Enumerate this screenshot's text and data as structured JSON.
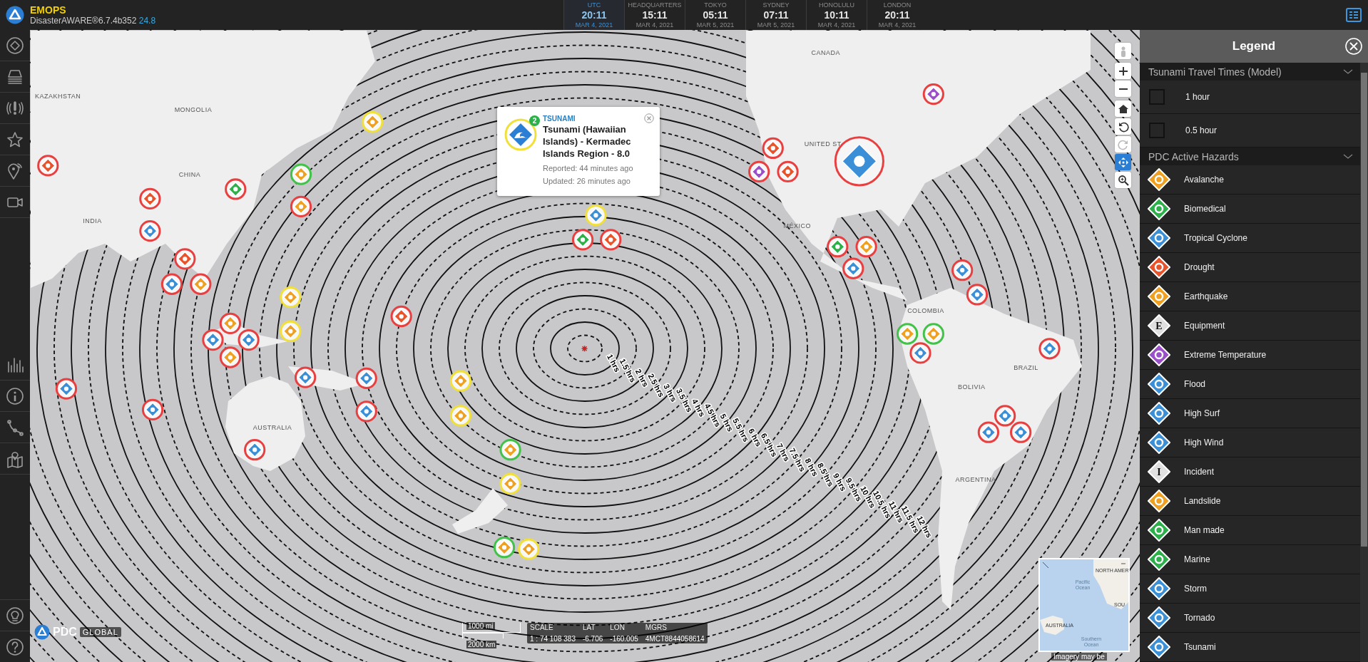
{
  "app": {
    "name": "EMOPS",
    "version": "DisasterAWARE®6.7.4b352",
    "build": "24.8"
  },
  "clocks": [
    {
      "label": "UTC",
      "time": "20:11",
      "date": "MAR 4, 2021",
      "selected": true
    },
    {
      "label": "HEADQUARTERS",
      "time": "15:11",
      "date": "MAR 4, 2021",
      "selected": false
    },
    {
      "label": "TOKYO",
      "time": "05:11",
      "date": "MAR 5, 2021",
      "selected": false
    },
    {
      "label": "SYDNEY",
      "time": "07:11",
      "date": "MAR 5, 2021",
      "selected": false
    },
    {
      "label": "HONOLULU",
      "time": "10:11",
      "date": "MAR 4, 2021",
      "selected": false
    },
    {
      "label": "LONDON",
      "time": "20:11",
      "date": "MAR 4, 2021",
      "selected": false
    }
  ],
  "map": {
    "places": [
      "KAZAKHSTAN",
      "MONGOLIA",
      "CHINA",
      "INDIA",
      "AUSTRALIA",
      "CANADA",
      "UNITED ST",
      "MÉXICO",
      "COLOMBIA",
      "BOLIVIA",
      "BRAZIL",
      "ARGENTINA"
    ],
    "contour_labels": [
      "1 hrs",
      "1.5 hrs",
      "2 hrs",
      "2.5 hrs",
      "3 hrs",
      "3.5 hrs",
      "4 hrs",
      "4.5 hrs",
      "5 hrs",
      "5.5 hrs",
      "6 hrs",
      "6.5 hrs",
      "7 hrs",
      "7.5 hrs",
      "8 hrs",
      "8.5 hrs",
      "9 hrs",
      "9.5 hrs",
      "10 hrs",
      "10.5 hrs",
      "11 hrs",
      "11.5 hrs",
      "12 hrs"
    ],
    "popup": {
      "category": "TSUNAMI",
      "count": "2",
      "title": "Tsunami (Hawaiian Islands) - Kermadec Islands Region - 8.0",
      "reported": "Reported: 44 minutes ago",
      "updated": "Updated: 26 minutes ago"
    },
    "logo": {
      "name": "PDC",
      "suffix": "GLOBAL"
    },
    "scale": {
      "miles": "1000 mi",
      "km": "2000 km"
    },
    "readouts": [
      {
        "label": "SCALE",
        "value": "1 : 74 108 383"
      },
      {
        "label": "LAT",
        "value": "-6.706"
      },
      {
        "label": "LON",
        "value": "-160.005"
      },
      {
        "label": "MGRS",
        "value": "4MCT8844058614"
      }
    ],
    "minimap": {
      "labels": [
        "NORTH AMER",
        "Pacific Ocean",
        "AUSTRALIA",
        "SOU",
        "Southern Ocean"
      ],
      "attribution": "Imagery may be"
    }
  },
  "legend": {
    "title": "Legend",
    "sections": [
      {
        "title": "Tsunami Travel Times (Model)",
        "expanded": true,
        "items": [
          {
            "label": "1 hour",
            "kind": "line"
          },
          {
            "label": "0.5 hour",
            "kind": "line"
          }
        ]
      },
      {
        "title": "PDC Active Hazards",
        "expanded": true,
        "items": [
          {
            "label": "Avalanche",
            "kind": "hazard",
            "color": "#f0a020"
          },
          {
            "label": "Biomedical",
            "kind": "hazard",
            "color": "#2bb04a"
          },
          {
            "label": "Tropical Cyclone",
            "kind": "hazard",
            "color": "#3a8fd6"
          },
          {
            "label": "Drought",
            "kind": "hazard",
            "color": "#e8532b"
          },
          {
            "label": "Earthquake",
            "kind": "hazard",
            "color": "#f0a020"
          },
          {
            "label": "Equipment",
            "kind": "hazard",
            "color": "#e0e0e0",
            "glyph": "E"
          },
          {
            "label": "Extreme Temperature",
            "kind": "hazard",
            "color": "#9b4fc8"
          },
          {
            "label": "Flood",
            "kind": "hazard",
            "color": "#3a8fd6"
          },
          {
            "label": "High Surf",
            "kind": "hazard",
            "color": "#3a8fd6"
          },
          {
            "label": "High Wind",
            "kind": "hazard",
            "color": "#3a8fd6"
          },
          {
            "label": "Incident",
            "kind": "hazard",
            "color": "#e0e0e0",
            "glyph": "I"
          },
          {
            "label": "Landslide",
            "kind": "hazard",
            "color": "#f0a020"
          },
          {
            "label": "Man made",
            "kind": "hazard",
            "color": "#2bb04a"
          },
          {
            "label": "Marine",
            "kind": "hazard",
            "color": "#2bb04a"
          },
          {
            "label": "Storm",
            "kind": "hazard",
            "color": "#3a8fd6"
          },
          {
            "label": "Tornado",
            "kind": "hazard",
            "color": "#3a8fd6"
          },
          {
            "label": "Tsunami",
            "kind": "hazard",
            "color": "#3a8fd6"
          }
        ]
      }
    ]
  }
}
